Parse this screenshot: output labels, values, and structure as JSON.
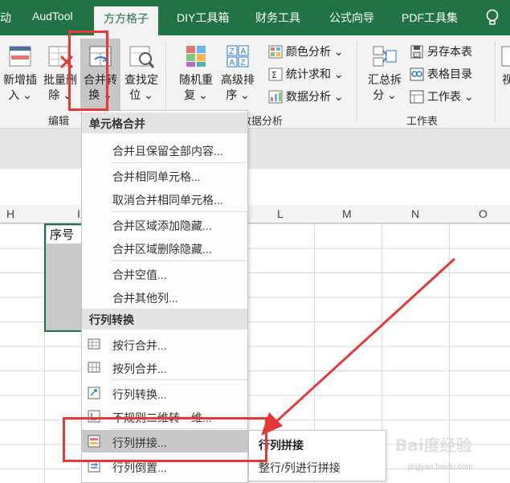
{
  "tabs": [
    {
      "label": "动",
      "active": false
    },
    {
      "label": "AudTool",
      "active": false
    },
    {
      "label": "方方格子",
      "active": true
    },
    {
      "label": "DIY工具箱",
      "active": false
    },
    {
      "label": "财务工具",
      "active": false
    },
    {
      "label": "公式向导",
      "active": false
    },
    {
      "label": "PDF工具集",
      "active": false
    }
  ],
  "ribbon": {
    "new_insert": {
      "line1": "新增插",
      "line2": "入 ⌄"
    },
    "batch_delete": {
      "line1": "批量删",
      "line2": "除 ⌄"
    },
    "merge_convert": {
      "line1": "合并转",
      "line2": "换 ⌄"
    },
    "find_locate": {
      "line1": "查找定",
      "line2": "位 ⌄"
    },
    "random_repeat": {
      "line1": "随机重",
      "line2": "复 ⌄"
    },
    "advanced_sort": {
      "line1": "高级排",
      "line2": "序 ⌄"
    },
    "color_analysis": "颜色分析 ⌄",
    "stat_sum": "统计求和 ⌄",
    "data_analysis": "数据分析 ⌄",
    "summary_split": {
      "line1": "汇总拆",
      "line2": "分 ⌄"
    },
    "save_sheet": "另存本表",
    "sheet_directory": "表格目录",
    "worksheet": "工作表 ⌄",
    "view_partial": "视",
    "group_edit": "编辑",
    "group_data_analysis": "数据分析",
    "group_worksheet": "工作表"
  },
  "grid": {
    "col_headers": [
      "H",
      "I",
      "L",
      "M",
      "N",
      "O"
    ],
    "cell_text": "序号"
  },
  "menu": {
    "section1": "单元格合并",
    "items1": [
      "合并且保留全部内容...",
      "合并相同单元格...",
      "取消合并相同单元格...",
      "合并区域添加隐藏...",
      "合并区域删除隐藏...",
      "合并空值...",
      "合并其他列..."
    ],
    "section2": "行列转换",
    "items2": [
      "按行合并...",
      "按列合并...",
      "行列转换...",
      "不规则二维转一维...",
      "行列拼接...",
      "行列倒置..."
    ]
  },
  "tooltip": {
    "title": "行列拼接",
    "desc": "整行/列进行拼接"
  },
  "watermark": {
    "text": "Bai度经验",
    "sub": "jingyan.baidu.com"
  },
  "colors": {
    "excel_green": "#217346",
    "highlight_red": "#e53935"
  }
}
